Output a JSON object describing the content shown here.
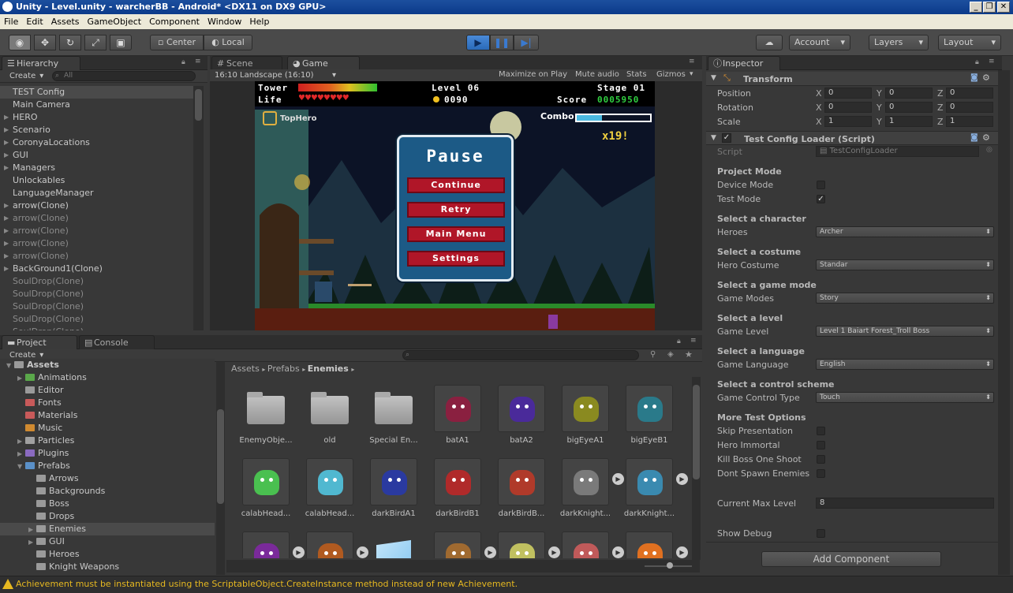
{
  "window": {
    "title": "Unity - Level.unity - warcherBB - Android* <DX11 on DX9 GPU>"
  },
  "menu": [
    "File",
    "Edit",
    "Assets",
    "GameObject",
    "Component",
    "Window",
    "Help"
  ],
  "toolbar": {
    "pivot": "Center",
    "space": "Local",
    "account": "Account",
    "layers": "Layers",
    "layout": "Layout"
  },
  "hierarchy": {
    "tab": "Hierarchy",
    "create": "Create",
    "search_placeholder": "All",
    "items": [
      {
        "label": "TEST Config",
        "arrow": false,
        "dim": false,
        "selected": true
      },
      {
        "label": "Main Camera",
        "arrow": false,
        "dim": false
      },
      {
        "label": "HERO",
        "arrow": true,
        "dim": false
      },
      {
        "label": "Scenario",
        "arrow": true,
        "dim": false
      },
      {
        "label": "CoronyaLocations",
        "arrow": true,
        "dim": false
      },
      {
        "label": "GUI",
        "arrow": true,
        "dim": false
      },
      {
        "label": "Managers",
        "arrow": true,
        "dim": false
      },
      {
        "label": "Unlockables",
        "arrow": false,
        "dim": false
      },
      {
        "label": "LanguageManager",
        "arrow": false,
        "dim": false
      },
      {
        "label": "arrow(Clone)",
        "arrow": true,
        "dim": false
      },
      {
        "label": "arrow(Clone)",
        "arrow": true,
        "dim": true
      },
      {
        "label": "arrow(Clone)",
        "arrow": true,
        "dim": true
      },
      {
        "label": "arrow(Clone)",
        "arrow": true,
        "dim": true
      },
      {
        "label": "arrow(Clone)",
        "arrow": true,
        "dim": true
      },
      {
        "label": "BackGround1(Clone)",
        "arrow": true,
        "dim": false
      },
      {
        "label": "SoulDrop(Clone)",
        "arrow": false,
        "dim": true
      },
      {
        "label": "SoulDrop(Clone)",
        "arrow": false,
        "dim": true
      },
      {
        "label": "SoulDrop(Clone)",
        "arrow": false,
        "dim": true
      },
      {
        "label": "SoulDrop(Clone)",
        "arrow": false,
        "dim": true
      },
      {
        "label": "SoulDrop(Clone)",
        "arrow": false,
        "dim": true
      }
    ]
  },
  "viewtabs": {
    "scene": "Scene",
    "game": "Game"
  },
  "gamebar": {
    "aspect": "16:10 Landscape (16:10)",
    "maximize": "Maximize on Play",
    "mute": "Mute audio",
    "stats": "Stats",
    "gizmos": "Gizmos"
  },
  "game": {
    "tower": "Tower",
    "life": "Life",
    "level": "Level 06",
    "coins": "0090",
    "stage": "Stage 01",
    "score_label": "Score",
    "score": "0005950",
    "combo_label": "Combo",
    "combo_count": "x19!",
    "player": "TopHero",
    "pause": {
      "title": "Pause",
      "buttons": [
        "Continue",
        "Retry",
        "Main Menu",
        "Settings"
      ]
    }
  },
  "inspector": {
    "tab": "Inspector",
    "transform": {
      "title": "Transform",
      "rows": [
        {
          "label": "Position",
          "x": "0",
          "y": "0",
          "z": "0"
        },
        {
          "label": "Rotation",
          "x": "0",
          "y": "0",
          "z": "0"
        },
        {
          "label": "Scale",
          "x": "1",
          "y": "1",
          "z": "1"
        }
      ]
    },
    "script_comp": {
      "title": "Test Config Loader (Script)",
      "script_label": "Script",
      "script_value": "TestConfigLoader"
    },
    "project_mode": {
      "header": "Project Mode",
      "device": "Device Mode",
      "test": "Test Mode"
    },
    "character": {
      "header": "Select a character",
      "label": "Heroes",
      "value": "Archer"
    },
    "costume": {
      "header": "Select a costume",
      "label": "Hero Costume",
      "value": "Standar"
    },
    "gamemode": {
      "header": "Select a game mode",
      "label": "Game Modes",
      "value": "Story"
    },
    "level": {
      "header": "Select a level",
      "label": "Game Level",
      "value": "Level 1 Baiart Forest_Troll Boss"
    },
    "language": {
      "header": "Select a language",
      "label": "Game Language",
      "value": "English"
    },
    "control": {
      "header": "Select a control scheme",
      "label": "Game Control Type",
      "value": "Touch"
    },
    "more": {
      "header": "More Test Options",
      "skip": "Skip Presentation",
      "immortal": "Hero Immortal",
      "killboss": "Kill Boss One Shoot",
      "nospawn": "Dont Spawn Enemies"
    },
    "maxlevel": {
      "label": "Current Max Level",
      "value": "8"
    },
    "debug": {
      "label": "Show Debug"
    },
    "add_component": "Add Component"
  },
  "project": {
    "tab": "Project",
    "console_tab": "Console",
    "create": "Create",
    "breadcrumb": [
      "Assets",
      "Prefabs",
      "Enemies"
    ],
    "tree": [
      {
        "label": "Assets",
        "indent": 0,
        "color": "#9a9a9a",
        "bold": true
      },
      {
        "label": "Animations",
        "indent": 1,
        "color": "#5aa84a"
      },
      {
        "label": "Editor",
        "indent": 1,
        "color": "#9a9a9a"
      },
      {
        "label": "Fonts",
        "indent": 1,
        "color": "#c85a5a"
      },
      {
        "label": "Materials",
        "indent": 1,
        "color": "#c85a5a"
      },
      {
        "label": "Music",
        "indent": 1,
        "color": "#d08a30"
      },
      {
        "label": "Particles",
        "indent": 1,
        "color": "#a0a0a0"
      },
      {
        "label": "Plugins",
        "indent": 1,
        "color": "#8a6ac0"
      },
      {
        "label": "Prefabs",
        "indent": 1,
        "color": "#5a90c8"
      },
      {
        "label": "Arrows",
        "indent": 2,
        "color": "#9a9a9a"
      },
      {
        "label": "Backgrounds",
        "indent": 2,
        "color": "#9a9a9a"
      },
      {
        "label": "Boss",
        "indent": 2,
        "color": "#9a9a9a"
      },
      {
        "label": "Drops",
        "indent": 2,
        "color": "#9a9a9a"
      },
      {
        "label": "Enemies",
        "indent": 2,
        "color": "#9a9a9a",
        "selected": true
      },
      {
        "label": "GUI",
        "indent": 2,
        "color": "#9a9a9a"
      },
      {
        "label": "Heroes",
        "indent": 2,
        "color": "#9a9a9a"
      },
      {
        "label": "Knight Weapons",
        "indent": 2,
        "color": "#9a9a9a"
      }
    ],
    "assets": [
      {
        "label": "EnemyObje...",
        "kind": "folder",
        "color": "#9a9a9a"
      },
      {
        "label": "old",
        "kind": "folder",
        "color": "#9a9a9a"
      },
      {
        "label": "Special En...",
        "kind": "folder",
        "color": "#9a9a9a"
      },
      {
        "label": "batA1",
        "kind": "sprite",
        "color": "#8a2040"
      },
      {
        "label": "batA2",
        "kind": "sprite",
        "color": "#4a2a9a"
      },
      {
        "label": "bigEyeA1",
        "kind": "sprite",
        "color": "#8a8a20"
      },
      {
        "label": "bigEyeB1",
        "kind": "sprite",
        "color": "#2a7a8a"
      },
      {
        "label": "calabHead...",
        "kind": "sprite",
        "color": "#4ac050"
      },
      {
        "label": "calabHead...",
        "kind": "sprite",
        "color": "#50b8d0"
      },
      {
        "label": "darkBirdA1",
        "kind": "sprite",
        "color": "#2a3aa0"
      },
      {
        "label": "darkBirdB1",
        "kind": "sprite",
        "color": "#b02a2a"
      },
      {
        "label": "darkBirdB...",
        "kind": "sprite",
        "color": "#b03a2a"
      },
      {
        "label": "darkKnight...",
        "kind": "sprite",
        "color": "#7a7a7a",
        "play": true
      },
      {
        "label": "darkKnight...",
        "kind": "sprite",
        "color": "#3a8ab0",
        "play": true
      },
      {
        "label": "",
        "kind": "sprite",
        "color": "#7a2a9a",
        "play": true
      },
      {
        "label": "",
        "kind": "sprite",
        "color": "#b05a20",
        "play": true
      },
      {
        "label": "",
        "kind": "cube",
        "color": "#8ac8f0"
      },
      {
        "label": "",
        "kind": "sprite",
        "color": "#a06a30",
        "play": true
      },
      {
        "label": "",
        "kind": "sprite",
        "color": "#c0c060",
        "play": true
      },
      {
        "label": "",
        "kind": "sprite",
        "color": "#c05a5a",
        "play": true
      },
      {
        "label": "",
        "kind": "sprite",
        "color": "#e07020",
        "play": true
      }
    ]
  },
  "status": "Achievement must be instantiated using the ScriptableObject.CreateInstance method instead of new Achievement."
}
